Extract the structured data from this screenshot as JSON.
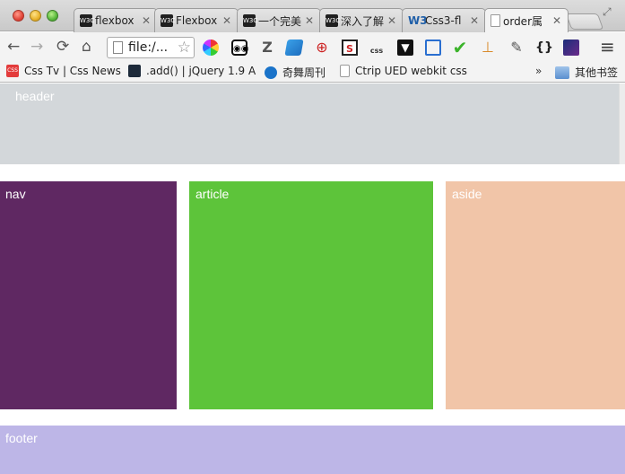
{
  "tabs": [
    {
      "title": "flexbox",
      "icon": "w3c-favicon-icon",
      "fav": "W3C"
    },
    {
      "title": "Flexbox",
      "icon": "w3c-favicon-icon",
      "fav": "W3C"
    },
    {
      "title": "一个完美",
      "icon": "w3c-favicon-icon",
      "fav": "W3C"
    },
    {
      "title": "深入了解",
      "icon": "w3c-favicon-icon",
      "fav": "W3C"
    },
    {
      "title": "Css3-fl",
      "icon": "w3-favicon-icon",
      "fav": "W3"
    },
    {
      "title": "order属",
      "icon": "page-icon",
      "fav": ""
    }
  ],
  "tab_close_glyph": "✕",
  "toolbar": {
    "back": "←",
    "forward": "→",
    "reload": "⟳",
    "home": "⌂",
    "url": "file:/...",
    "bookmark_star": "☆",
    "menu": "≡"
  },
  "bookmarks": [
    {
      "label": "Css Tv | Css News",
      "color": "#e33b3b"
    },
    {
      "label": ".add() | jQuery 1.9 A",
      "color": "#1d2a3a"
    },
    {
      "label": "奇舞周刊",
      "color": "#1a73c9"
    },
    {
      "label": "Ctrip UED webkit css",
      "color": "#ffffff"
    }
  ],
  "bookmarks_more": "»",
  "other_bookmarks": "其他书签",
  "page": {
    "header": "header",
    "nav": "nav",
    "article": "article",
    "aside": "aside",
    "footer": "footer"
  },
  "colors": {
    "header": "#d3d7da",
    "nav": "#5f2862",
    "article": "#5dc43a",
    "aside": "#f1c5a8",
    "footer": "#bdb6e7"
  }
}
